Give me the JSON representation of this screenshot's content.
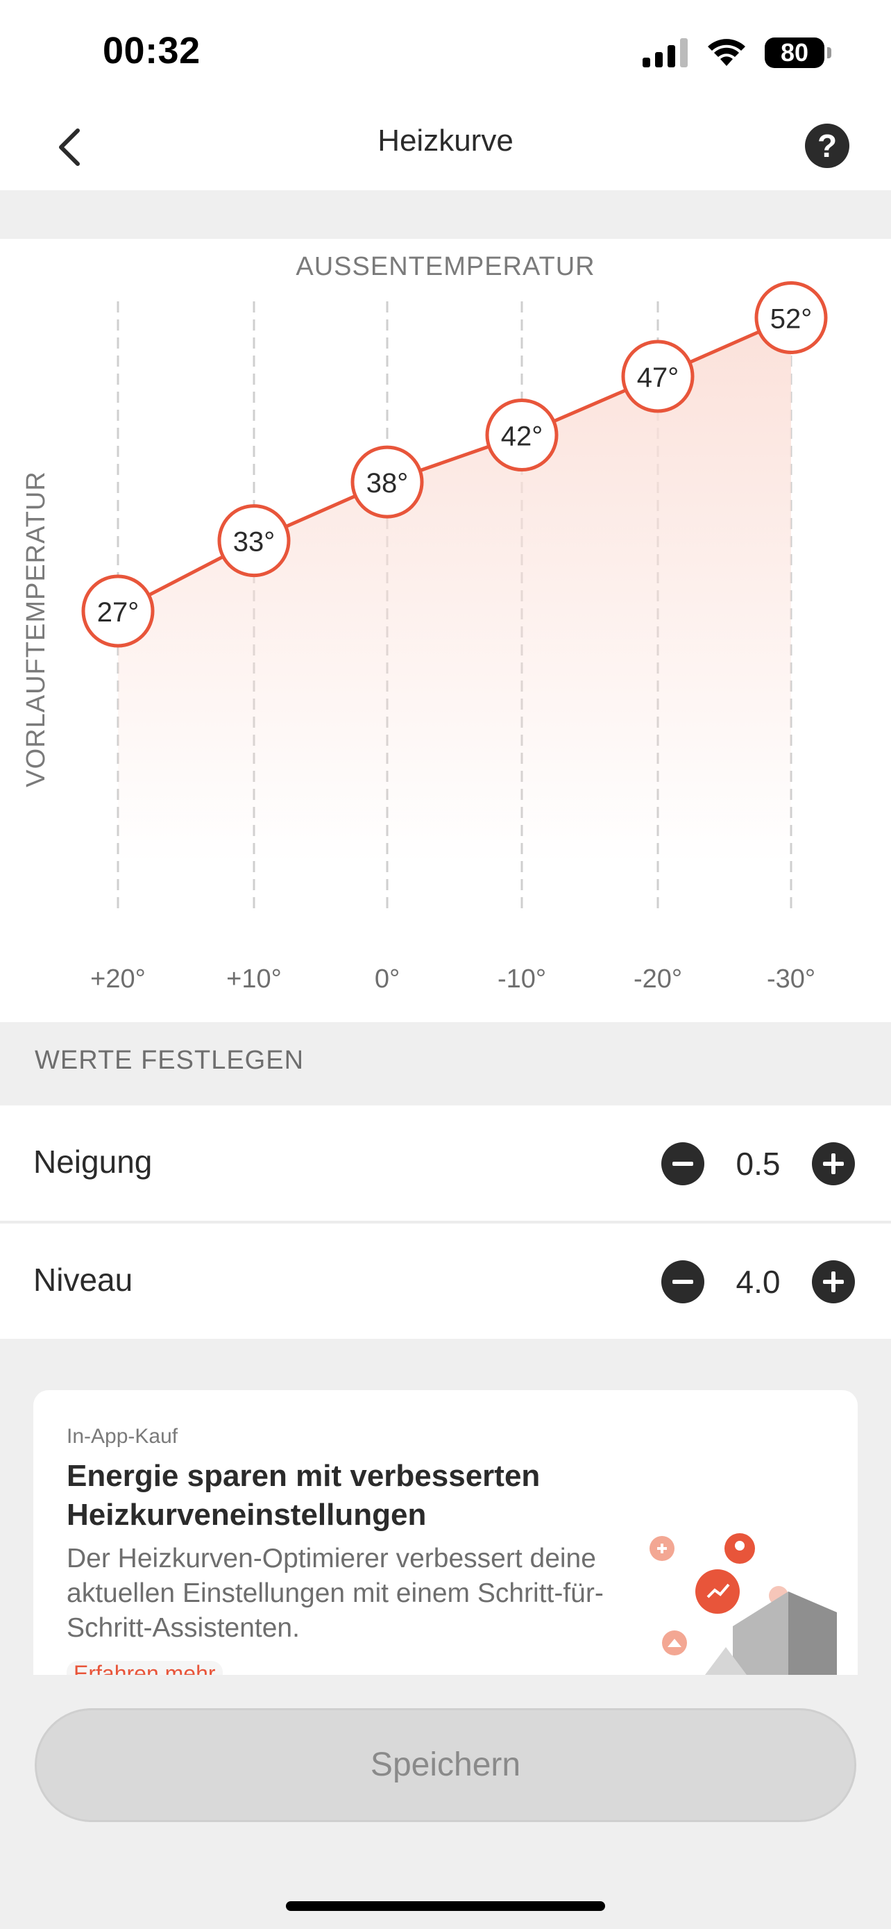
{
  "status_bar": {
    "time": "00:32",
    "battery": "80"
  },
  "nav": {
    "title": "Heizkurve",
    "back_icon": "chevron-left-icon",
    "help_label": "?"
  },
  "chart_data": {
    "type": "line",
    "title": "",
    "xlabel": "AUSSENTEMPERATUR",
    "ylabel": "VORLAUFTEMPERATUR",
    "categories": [
      "+20°",
      "+10°",
      "0°",
      "-10°",
      "-20°",
      "-30°"
    ],
    "x": [
      20,
      10,
      0,
      -10,
      -20,
      -30
    ],
    "series": [
      {
        "values": [
          27,
          33,
          38,
          42,
          47,
          52
        ],
        "labels": [
          "27°",
          "33°",
          "38°",
          "42°",
          "47°",
          "52°"
        ]
      }
    ],
    "ylim": [
      0,
      60
    ],
    "grid": "vertical-dashed",
    "line_color": "#e8553a",
    "fill_color": "#fbe1da"
  },
  "settings": {
    "section_title": "WERTE FESTLEGEN",
    "rows": [
      {
        "label": "Neigung",
        "value": "0.5"
      },
      {
        "label": "Niveau",
        "value": "4.0"
      }
    ]
  },
  "promo": {
    "kicker": "In-App-Kauf",
    "title": "Energie sparen mit verbesserten Heizkurveneinstellungen",
    "description": "Der Heizkurven-Optimierer verbessert deine aktuellen Einstellungen mit einem Schritt-für-Schritt-Assistenten.",
    "link": "Erfahren mehr"
  },
  "save_label": "Speichern",
  "colors": {
    "accent": "#e8553a",
    "background": "#efefef",
    "button_disabled": "#d9d9d9"
  }
}
